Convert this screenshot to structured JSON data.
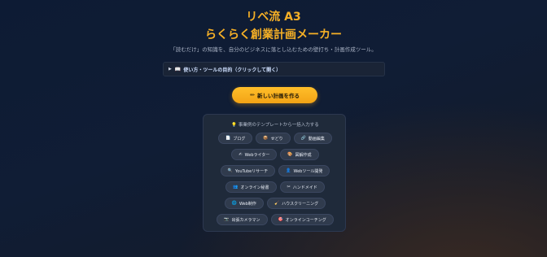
{
  "header": {
    "title_line1": "リベ流 A3",
    "title_line2": "らくらく創業計画メーカー",
    "subtitle": "「読むだけ」の知識を、自分のビジネスに落とし込むための壁打ち・計画作成ツール。"
  },
  "details": {
    "label": "使い方・ツールの目的（クリックして開く）"
  },
  "cta": {
    "label": "新しい計画を作る"
  },
  "templates": {
    "title": "事業例のテンプレートから一括入力する",
    "rows": [
      [
        {
          "label": "ブログ",
          "icon": "📄"
        },
        {
          "label": "せどり",
          "icon": "📦"
        },
        {
          "label": "動画編集",
          "icon": "🔗"
        }
      ],
      [
        {
          "label": "Webライター",
          "icon": "✍"
        },
        {
          "label": "図解作成",
          "icon": "🎨"
        }
      ],
      [
        {
          "label": "YouTubeリサーチ",
          "icon": "🔍"
        },
        {
          "label": "Webツール開発",
          "icon": "👤"
        }
      ],
      [
        {
          "label": "オンライン秘書",
          "icon": "👥"
        },
        {
          "label": "ハンドメイド",
          "icon": "✂"
        }
      ],
      [
        {
          "label": "Web制作",
          "icon": "🌐"
        },
        {
          "label": "ハウスクリーニング",
          "icon": "🧹"
        }
      ],
      [
        {
          "label": "出張カメラマン",
          "icon": "📷"
        },
        {
          "label": "オンラインコーチング",
          "icon": "🎯"
        }
      ]
    ]
  },
  "icons": {
    "details_toggle": "triangle-right-icon",
    "details_book": "book-icon",
    "cta_pen": "pencil-icon",
    "templates_bulb": "lightbulb-icon"
  },
  "colors": {
    "accent": "#f6b026",
    "background": "#0f1c33"
  }
}
